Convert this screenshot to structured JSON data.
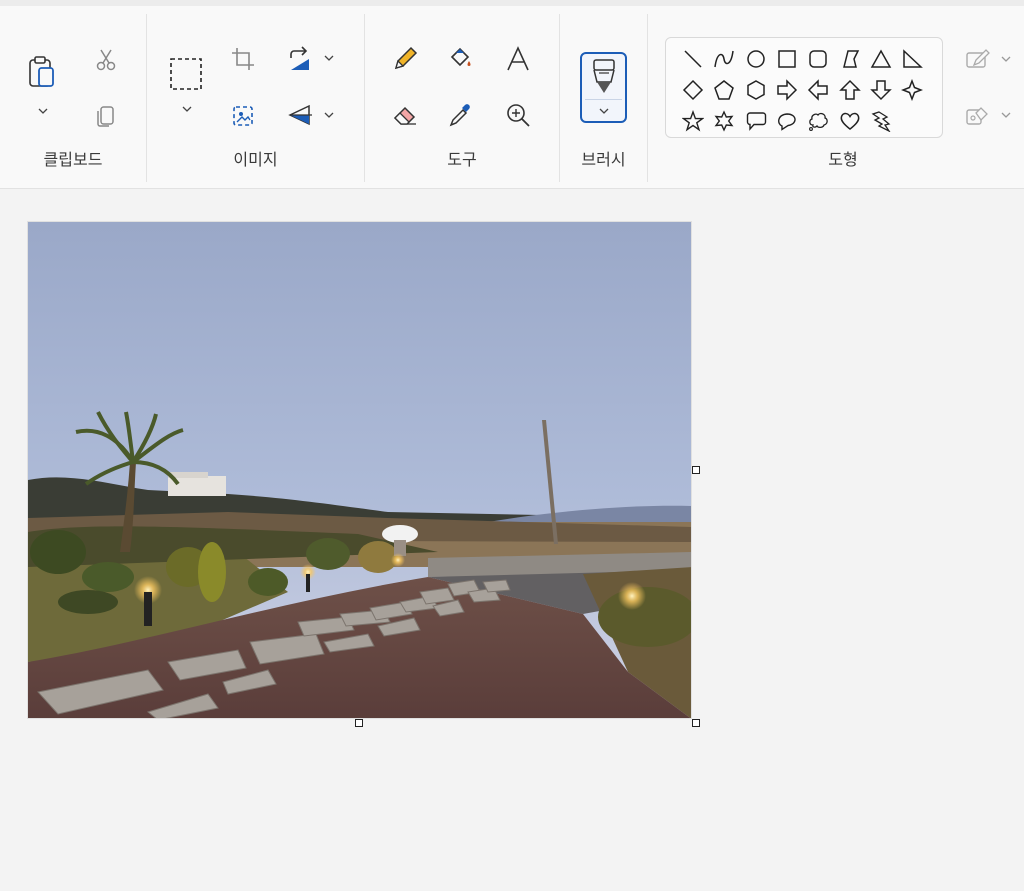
{
  "ribbon": {
    "groups": {
      "clipboard": "클립보드",
      "image": "이미지",
      "tools": "도구",
      "brushes": "브러시",
      "shapes": "도형"
    }
  },
  "icons": {
    "clipboard": [
      "paste-icon",
      "cut-icon",
      "copy-icon"
    ],
    "image": [
      "select-rectangle-icon",
      "crop-icon",
      "resize-icon",
      "rotate-icon",
      "flip-icon"
    ],
    "tools": [
      "pencil-icon",
      "fill-bucket-icon",
      "text-icon",
      "eraser-icon",
      "color-picker-icon",
      "magnifier-icon"
    ],
    "brushes": [
      "brush-icon"
    ],
    "shapes": [
      "line",
      "curve",
      "oval",
      "rectangle",
      "rounded-rectangle",
      "polygon",
      "triangle",
      "right-triangle",
      "diamond",
      "pentagon",
      "hexagon",
      "right-arrow",
      "left-arrow",
      "up-arrow",
      "down-arrow",
      "four-point-star",
      "five-point-star",
      "six-point-star",
      "rounded-callout",
      "oval-callout",
      "cloud-callout",
      "heart",
      "lightning"
    ],
    "shape_options": [
      "outline-icon",
      "fill-icon"
    ]
  },
  "colors": {
    "accent": "#1c5db7",
    "ribbon_bg": "#f9f9f9",
    "canvas_bg": "#f3f3f3"
  }
}
